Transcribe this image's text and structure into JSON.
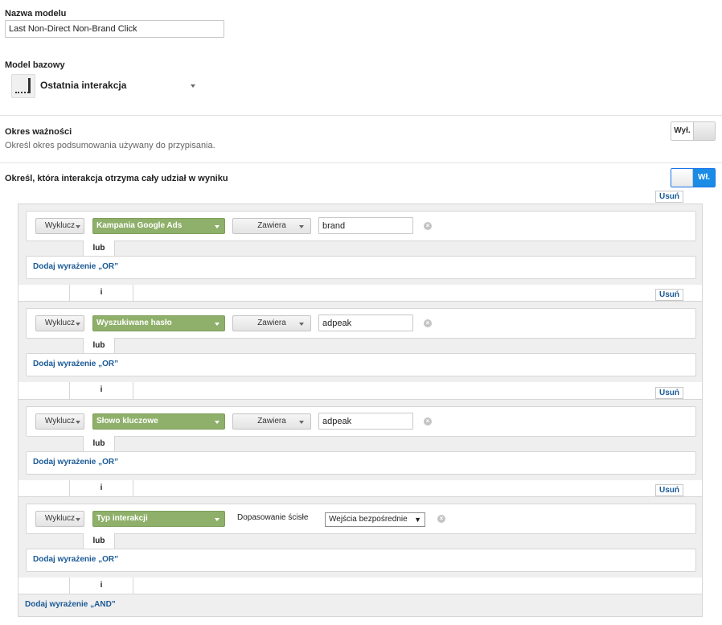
{
  "model_name": {
    "label": "Nazwa modelu",
    "value": "Last Non-Direct Non-Brand Click"
  },
  "base_model": {
    "label": "Model bazowy",
    "selected": "Ostatnia interakcja",
    "icon": "last-interaction-model-icon"
  },
  "lookback": {
    "title": "Okres ważności",
    "description": "Określ okres podsumowania używany do przypisania.",
    "toggle_label": "Wył.",
    "state": "off"
  },
  "full_credit": {
    "title": "Określ, która interakcja otrzyma cały udział w wyniku",
    "toggle_label": "Wł.",
    "state": "on"
  },
  "remove_label": "Usuń",
  "or_label": "lub",
  "and_label": "i",
  "add_or_label": "Dodaj wyrażenie „OR”",
  "add_and_label": "Dodaj wyrażenie „AND”",
  "rules": [
    {
      "include_mode": "Wyklucz",
      "dimension": "Kampania Google Ads",
      "operator": "Zawiera",
      "value": "brand"
    },
    {
      "include_mode": "Wyklucz",
      "dimension": "Wyszukiwane hasło",
      "operator": "Zawiera",
      "value": "adpeak"
    },
    {
      "include_mode": "Wyklucz",
      "dimension": "Słowo kluczowe",
      "operator": "Zawiera",
      "value": "adpeak"
    },
    {
      "include_mode": "Wyklucz",
      "dimension": "Typ interakcji",
      "operator": "Dopasowanie ścisłe",
      "value": "Wejścia bezpośrednie"
    }
  ],
  "colors": {
    "dimension_green": "#8fb06a",
    "link_blue": "#1a5a96",
    "toggle_on_blue": "#1a8ce6"
  }
}
